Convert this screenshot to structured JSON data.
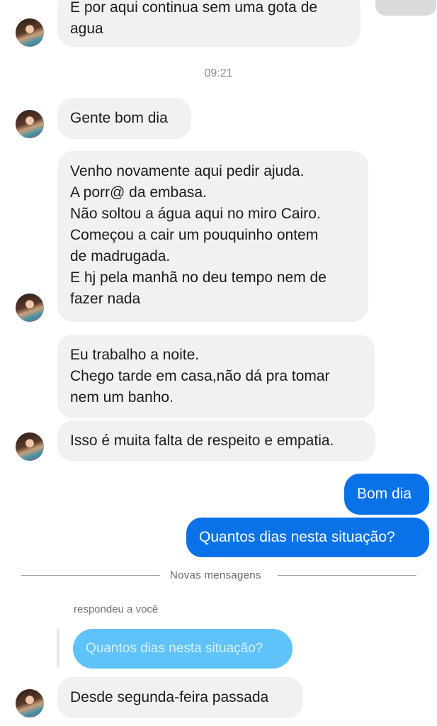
{
  "chat": {
    "top_message": [
      "E por aqui continua sem uma gota de",
      "agua"
    ],
    "timestamp": "09:21",
    "messages": [
      {
        "lines": [
          "Gente bom dia"
        ]
      },
      {
        "lines": [
          "Venho novamente aqui pedir ajuda.",
          "A porr@ da embasa.",
          "Não soltou a água aqui no miro Cairo.",
          "Começou a cair um pouquinho ontem",
          "de madrugada.",
          "E hj pela manhã no deu tempo nem de",
          "fazer nada"
        ]
      },
      {
        "lines": [
          "Eu trabalho a  noite.",
          "Chego tarde em casa,não dá pra tomar",
          "nem um banho."
        ]
      },
      {
        "lines": [
          "Isso é muita falta de respeito e empatia."
        ]
      }
    ],
    "outgoing": [
      {
        "lines": [
          "Bom dia"
        ]
      },
      {
        "lines": [
          "Quantos dias nesta situação?"
        ]
      }
    ],
    "new_messages_label": "Novas mensagens",
    "reply": {
      "label": "respondeu a você",
      "quoted": "Quantos dias nesta situação?",
      "message": "Desde segunda-feira passada"
    }
  },
  "colors": {
    "incoming_bubble": "#f0f1f3",
    "outgoing_bubble": "#0a72e8",
    "quoted_bubble": "#5fc2f8"
  }
}
